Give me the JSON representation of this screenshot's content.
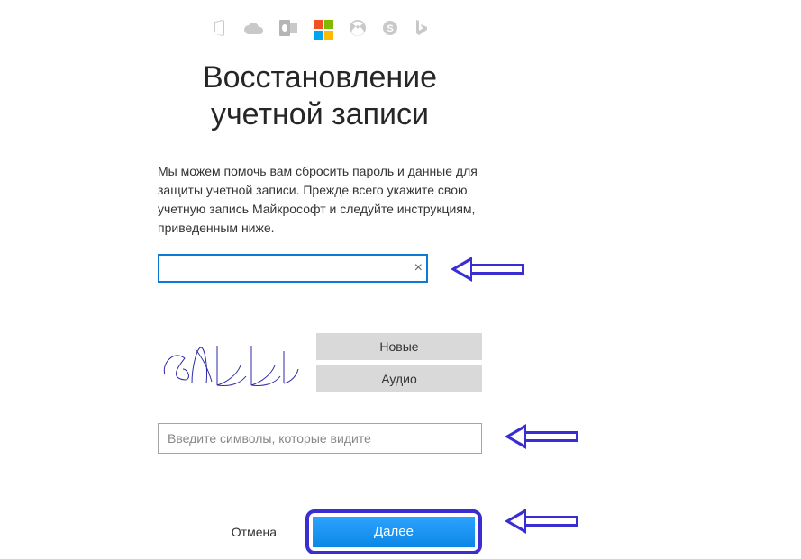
{
  "title_line1": "Восстановление",
  "title_line2": "учетной записи",
  "description": "Мы можем помочь вам сбросить пароль и данные для защиты учетной записи. Прежде всего укажите свою учетную запись Майкрософт и следуйте инструкциям, приведенным ниже.",
  "account_input": {
    "value": "",
    "clear_glyph": "×"
  },
  "captcha": {
    "text": "3рии",
    "new_label": "Новые",
    "audio_label": "Аудио",
    "input_placeholder": "Введите символы, которые видите",
    "input_value": ""
  },
  "actions": {
    "cancel": "Отмена",
    "next": "Далее"
  },
  "header_icons": [
    "office-icon",
    "onedrive-icon",
    "outlook-icon",
    "windows-logo-icon",
    "xbox-icon",
    "skype-icon",
    "bing-icon"
  ]
}
